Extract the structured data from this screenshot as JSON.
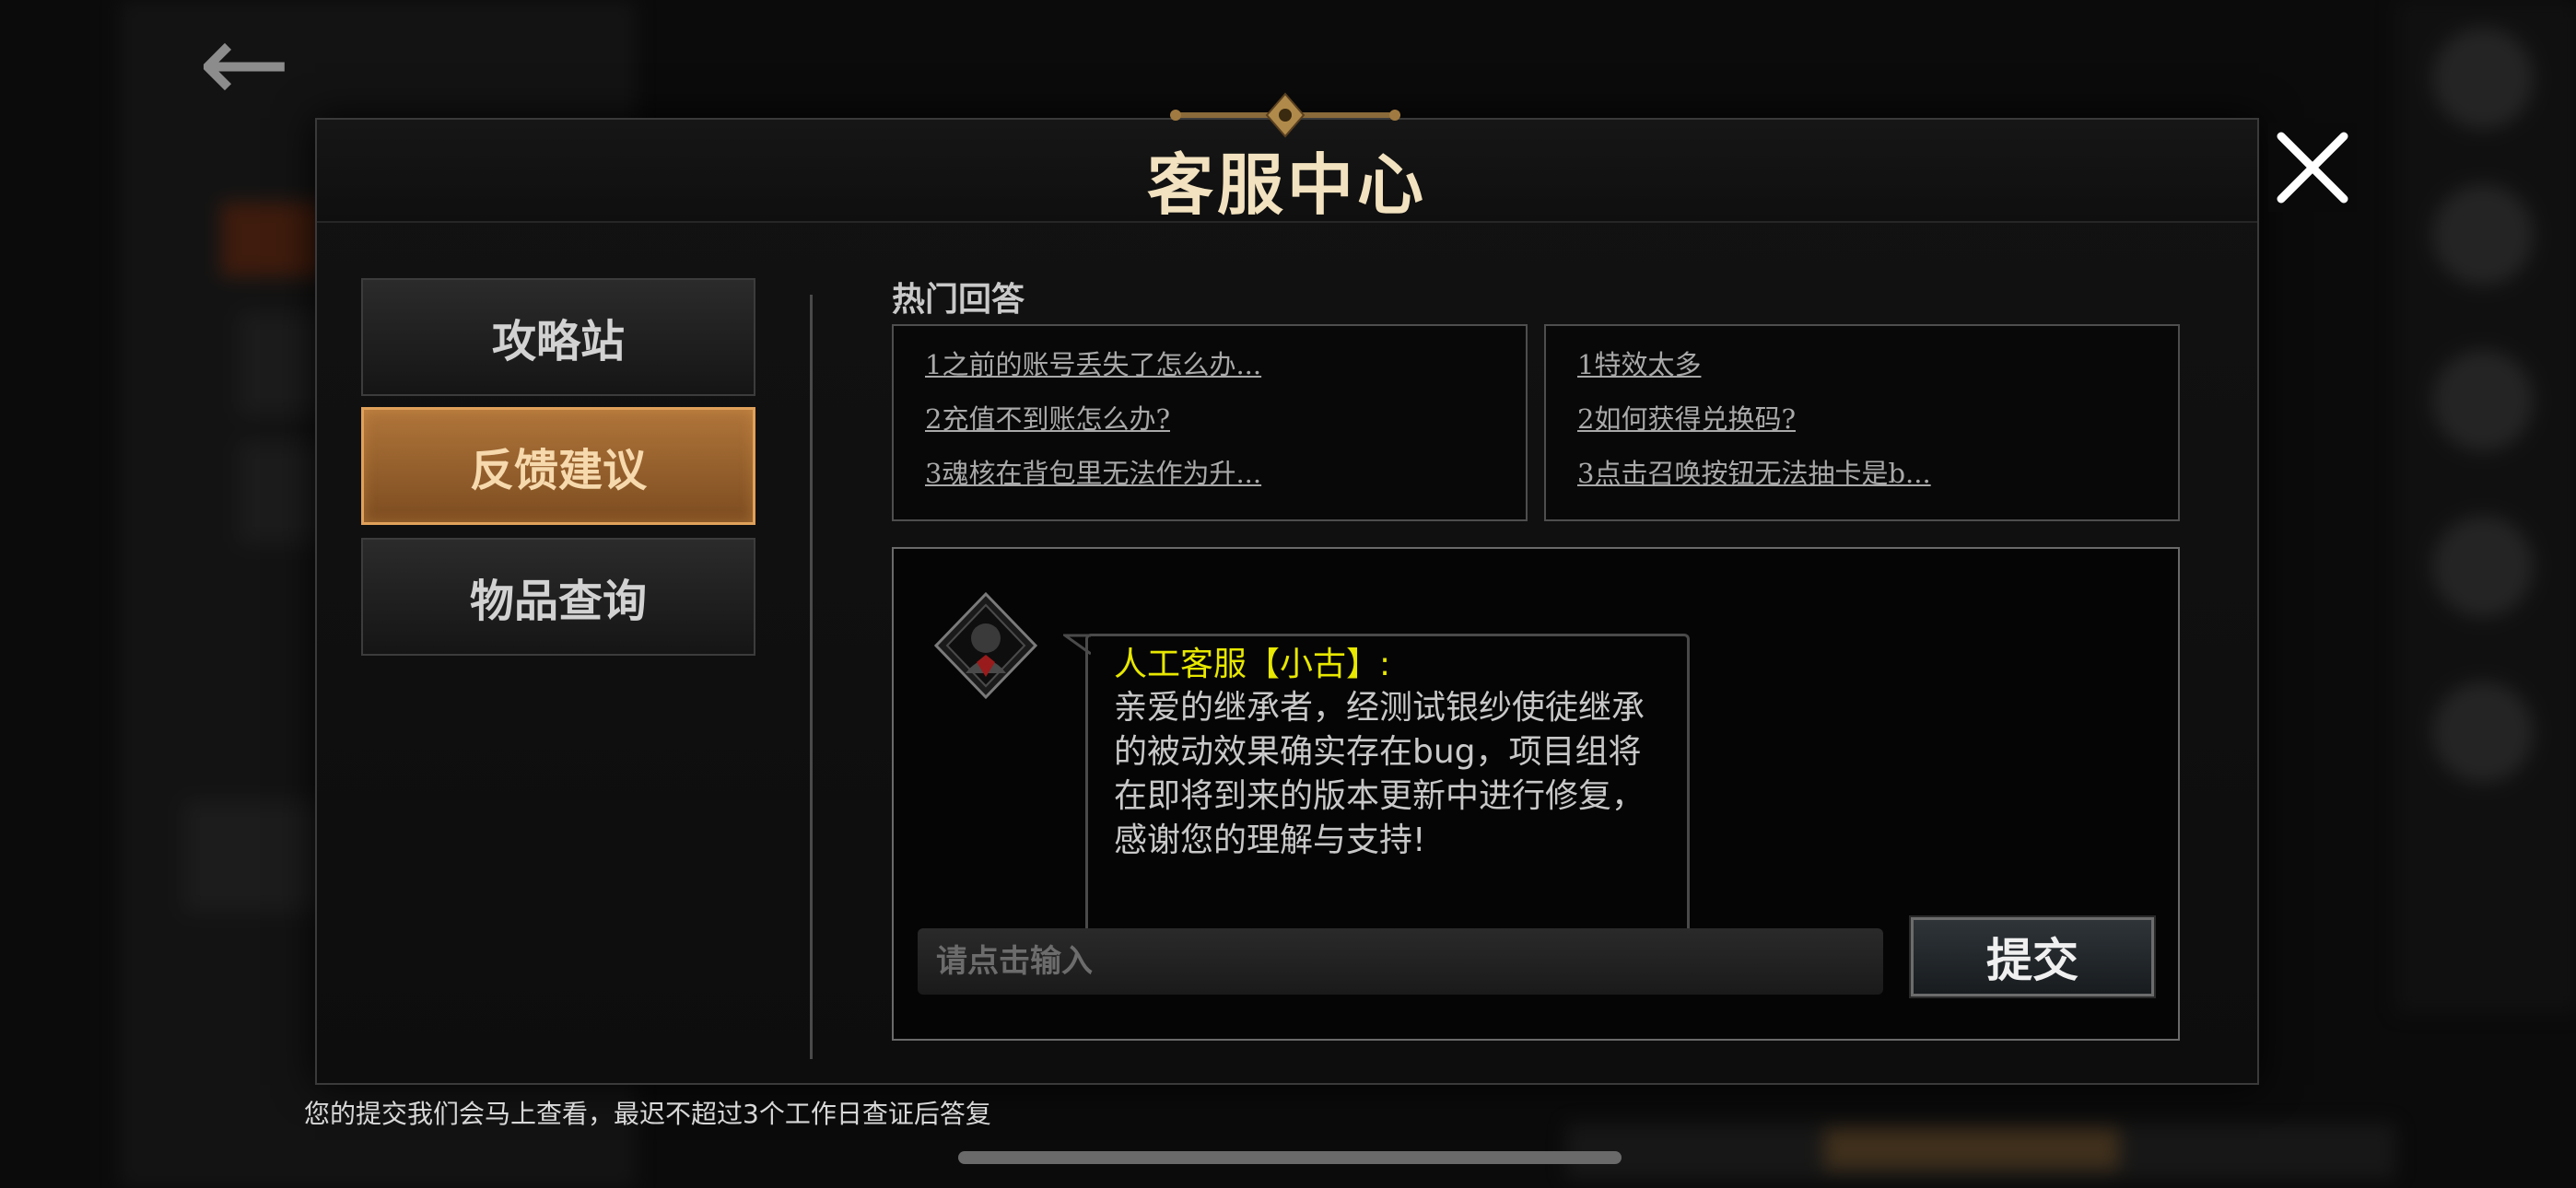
{
  "window": {
    "title": "客服中心",
    "close_icon": "close-x-icon"
  },
  "nav": {
    "items": [
      {
        "label": "攻略站",
        "active": false
      },
      {
        "label": "反馈建议",
        "active": true
      },
      {
        "label": "物品查询",
        "active": false
      }
    ]
  },
  "hot_answers": {
    "title": "热门回答",
    "left": [
      "1之前的账号丢失了怎么办...",
      "2充值不到账怎么办?",
      "3魂核在背包里无法作为升..."
    ],
    "right": [
      "1特效太多",
      "2如何获得兑换码?",
      "3点击召唤按钮无法抽卡是b..."
    ]
  },
  "chat": {
    "sender": "人工客服【小古】:",
    "message": "亲爱的继承者，经测试银纱使徒继承的被动效果确实存在bug，项目组将在即将到来的版本更新中进行修复，感谢您的理解与支持!",
    "input_placeholder": "请点击输入",
    "input_value": "",
    "submit_label": "提交"
  },
  "footer": {
    "note": "您的提交我们会马上查看，最迟不超过3个工作日查证后答复"
  },
  "colors": {
    "accent_gold": "#e0a15a",
    "sender_yellow": "#e8e800",
    "title_cream": "#f2e2bf"
  }
}
